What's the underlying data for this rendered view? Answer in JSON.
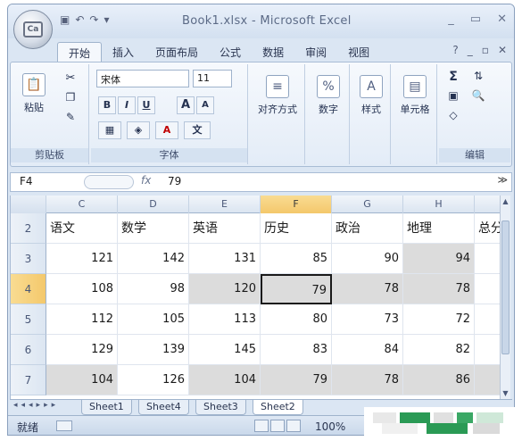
{
  "titlebar": {
    "title": "Book1.xlsx - Microsoft Excel",
    "office_logo": "Ca",
    "qat": [
      "▣",
      "↶",
      "↷",
      "▾"
    ],
    "controls": [
      "_",
      "▭",
      "✕"
    ]
  },
  "tabs": [
    "开始",
    "插入",
    "页面布局",
    "公式",
    "数据",
    "审阅",
    "视图"
  ],
  "tab_right": [
    "?",
    "_",
    "▫",
    "✕"
  ],
  "ribbon": {
    "clipboard": {
      "paste": "粘贴",
      "label": "剪贴板"
    },
    "font": {
      "name": "宋体",
      "size": "11",
      "bold": "B",
      "italic": "I",
      "underline": "U",
      "grow": "A",
      "shrink": "A",
      "wen": "文",
      "label": "字体"
    },
    "alignment": "对齐方式",
    "number": "数字",
    "styles": "样式",
    "cells": "单元格",
    "editing": {
      "sigma": "Σ",
      "label": "编辑"
    }
  },
  "formula_bar": {
    "name_box": "F4",
    "fx": "fx",
    "value": "79"
  },
  "grid": {
    "columns": [
      "C",
      "D",
      "E",
      "F",
      "G",
      "H"
    ],
    "selected_column": "F",
    "rows": [
      {
        "num": "2",
        "cells": [
          "语文",
          "数学",
          "英语",
          "历史",
          "政治",
          "地理",
          "总分"
        ]
      },
      {
        "num": "3",
        "cells": [
          "121",
          "142",
          "131",
          "85",
          "90",
          "94"
        ]
      },
      {
        "num": "4",
        "cells": [
          "108",
          "98",
          "120",
          "79",
          "78",
          "78"
        ]
      },
      {
        "num": "5",
        "cells": [
          "112",
          "105",
          "113",
          "80",
          "73",
          "72"
        ]
      },
      {
        "num": "6",
        "cells": [
          "129",
          "139",
          "145",
          "83",
          "84",
          "82"
        ]
      },
      {
        "num": "7",
        "cells": [
          "104",
          "126",
          "104",
          "79",
          "78",
          "86"
        ]
      }
    ],
    "selected_row": "4",
    "active_cell": "F4"
  },
  "sheets": [
    "Sheet1",
    "Sheet4",
    "Sheet3",
    "Sheet2"
  ],
  "active_sheet": "Sheet2",
  "status": {
    "ready": "就绪",
    "zoom": "100%"
  }
}
